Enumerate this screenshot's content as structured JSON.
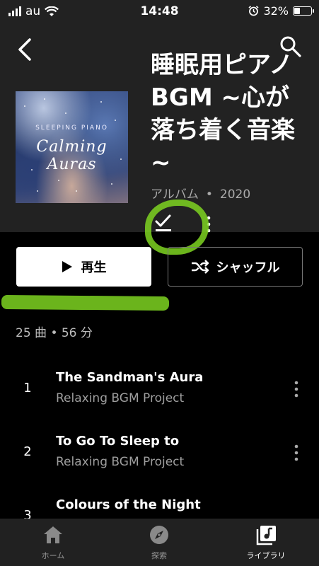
{
  "status_bar": {
    "carrier": "au",
    "time": "14:48",
    "battery": "32%",
    "battery_fraction": 0.32
  },
  "header": {
    "back_icon": "chevron-left-icon",
    "search_icon": "search-icon"
  },
  "album": {
    "title": "睡眠用ピアノBGM ~心が落ち着く音楽~",
    "type": "アルバム",
    "separator": "•",
    "year": "2020",
    "art_line1": "SLEEPING PIANO",
    "art_line2": "Calming Auras"
  },
  "actions": {
    "play_label": "再生",
    "shuffle_label": "シャッフル"
  },
  "summary": "25 曲 • 56 分",
  "tracks": [
    {
      "num": "1",
      "title": "The Sandman's Aura",
      "artist": "Relaxing BGM Project"
    },
    {
      "num": "2",
      "title": "To Go To Sleep to",
      "artist": "Relaxing BGM Project"
    },
    {
      "num": "3",
      "title": "Colours of the Night",
      "artist": ""
    }
  ],
  "nav": [
    {
      "label": "ホーム",
      "icon": "home-icon",
      "active": false
    },
    {
      "label": "探索",
      "icon": "compass-icon",
      "active": false
    },
    {
      "label": "ライブラリ",
      "icon": "library-icon",
      "active": true
    }
  ],
  "colors": {
    "annotation_green": "#7ed321",
    "header_bg": "#222222",
    "nav_bg": "#212121"
  }
}
